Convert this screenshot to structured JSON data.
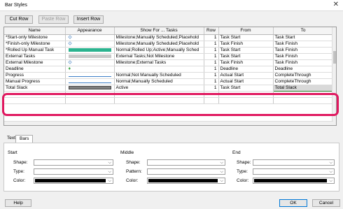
{
  "window": {
    "title": "Bar Styles",
    "close_glyph": "✕"
  },
  "toolbar": {
    "cut": "Cut Row",
    "paste": "Paste Row",
    "insert": "Insert Row"
  },
  "grid": {
    "columns": [
      "Name",
      "Appearance",
      "Show For ... Tasks",
      "Row",
      "From",
      "To"
    ],
    "rows": [
      {
        "name": "*Start-only Milestone",
        "appearance": "diamond-small",
        "show": "Milestone;Manually Scheduled;Placehold",
        "row": "1",
        "from": "Task Start",
        "to": "Task Start"
      },
      {
        "name": "*Finish-only Milestone",
        "appearance": "diamond-small",
        "show": "Milestone;Manually Scheduled;Placehold",
        "row": "1",
        "from": "Task Finish",
        "to": "Task Finish"
      },
      {
        "name": "*Rolled Up Manual Task",
        "appearance": "teal-bar",
        "show": "Normal;Rolled Up;Active;Manually Sched",
        "row": "1",
        "from": "Task Start",
        "to": "Task Finish"
      },
      {
        "name": "External Tasks",
        "appearance": "gray-bar",
        "show": "External Tasks;Not Milestone",
        "row": "1",
        "from": "Task Start",
        "to": "Task Finish"
      },
      {
        "name": "External Milestone",
        "appearance": "diamond-small",
        "show": "Milestone;External Tasks",
        "row": "1",
        "from": "Task Finish",
        "to": "Task Finish"
      },
      {
        "name": "Deadline",
        "appearance": "green-arrow",
        "show": "",
        "row": "1",
        "from": "Deadline",
        "to": "Deadline"
      },
      {
        "name": "Progress",
        "appearance": "thin-line",
        "show": "Normal;Not Manually Scheduled",
        "row": "1",
        "from": "Actual Start",
        "to": "CompleteThrough"
      },
      {
        "name": "Manual Progress",
        "appearance": "thin-line",
        "show": "Normal;Manually Scheduled",
        "row": "1",
        "from": "Actual Start",
        "to": "CompleteThrough"
      },
      {
        "name": "Total Slack",
        "appearance": "dark-gray-bar",
        "show": "Active",
        "row": "1",
        "from": "Task Start",
        "to": "Total Slack"
      },
      {
        "name": "",
        "appearance": "",
        "show": "",
        "row": "",
        "from": "",
        "to": ""
      },
      {
        "name": "",
        "appearance": "",
        "show": "",
        "row": "",
        "from": "",
        "to": ""
      }
    ]
  },
  "tabs": [
    "Text",
    "Bars"
  ],
  "bars_panel": {
    "sections": [
      {
        "title": "Start",
        "labels": [
          "Shape:",
          "Type:",
          "Color:"
        ]
      },
      {
        "title": "Middle",
        "labels": [
          "Shape:",
          "Pattern:",
          "Color:"
        ]
      },
      {
        "title": "End",
        "labels": [
          "Shape:",
          "Type:",
          "Color:"
        ]
      }
    ]
  },
  "footer": {
    "help": "Help",
    "ok": "OK",
    "cancel": "Cancel"
  },
  "colors": {
    "accent": "#0078d7",
    "highlight": "#e0185f",
    "teal": "#2bb38f",
    "slack": "#7f7f7f"
  }
}
